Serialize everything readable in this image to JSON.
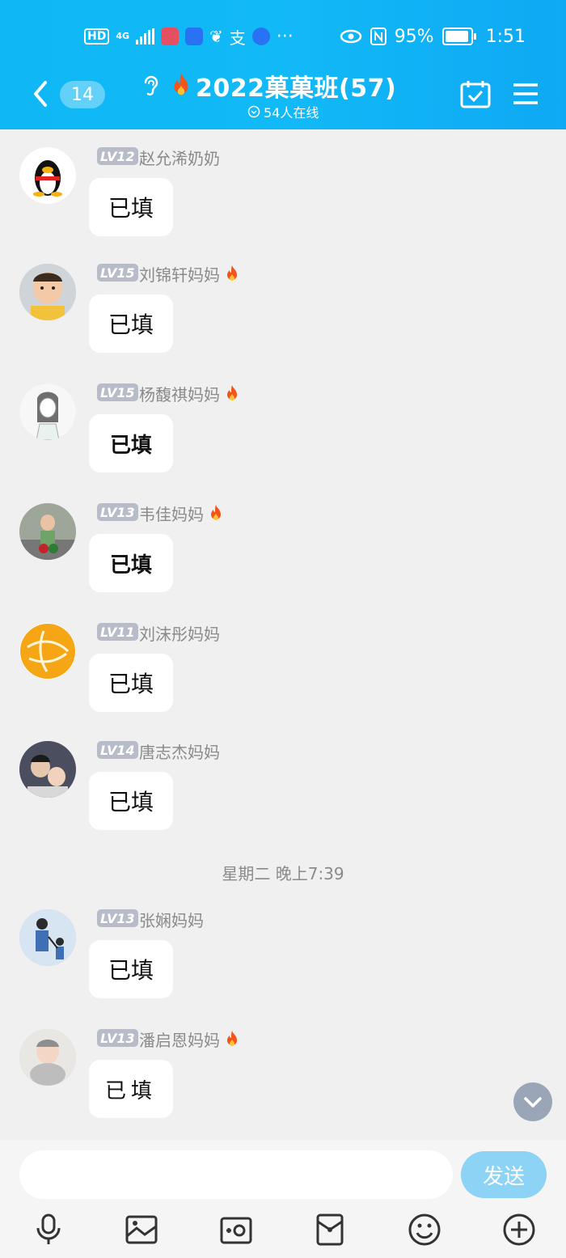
{
  "status_bar": {
    "left_icons": [
      "hd-icon",
      "4g-signal-icon",
      "app-icon-red",
      "app-icon-blue",
      "leaf-icon",
      "alipay-icon",
      "pinwheel-icon",
      "more-dots"
    ],
    "hd": "HD",
    "network": "4G",
    "more": "···",
    "battery": "95%",
    "time": "1:51"
  },
  "header": {
    "unread_count": "14",
    "title": "2022菓菓班(57)",
    "online_text": "54人在线"
  },
  "messages": [
    {
      "level": "LV12",
      "name": "赵允浠奶奶",
      "text": "已填",
      "fire": false,
      "avatar": "penguin"
    },
    {
      "level": "LV15",
      "name": "刘锦轩妈妈",
      "text": "已填",
      "fire": true,
      "avatar": "child-yellow"
    },
    {
      "level": "LV15",
      "name": "杨馥祺妈妈",
      "text": "已填",
      "fire": true,
      "avatar": "anime-girl"
    },
    {
      "level": "LV13",
      "name": "韦佳妈妈",
      "text": "已填",
      "fire": true,
      "avatar": "girl-outdoor"
    },
    {
      "level": "LV11",
      "name": "刘沫彤妈妈",
      "text": "已填",
      "fire": false,
      "avatar": "orange-ball"
    },
    {
      "level": "LV14",
      "name": "唐志杰妈妈",
      "text": "已填",
      "fire": false,
      "avatar": "kids-dark"
    },
    {
      "level": "LV13",
      "name": "张娴妈妈",
      "text": "已填",
      "fire": false,
      "avatar": "cartoon-family"
    },
    {
      "level": "LV13",
      "name": "潘启恩妈妈",
      "text": "已填",
      "fire": true,
      "avatar": "baby"
    }
  ],
  "timestamp": "星期二 晚上7:39",
  "input": {
    "placeholder": "",
    "send_label": "发送"
  },
  "toolbar": [
    "mic-icon",
    "image-icon",
    "camera-icon",
    "red-packet-icon",
    "emoji-icon",
    "plus-icon"
  ],
  "colors": {
    "header": "#12b9f7",
    "send": "#8dd3f5",
    "level_badge": "#b8bcc8"
  }
}
